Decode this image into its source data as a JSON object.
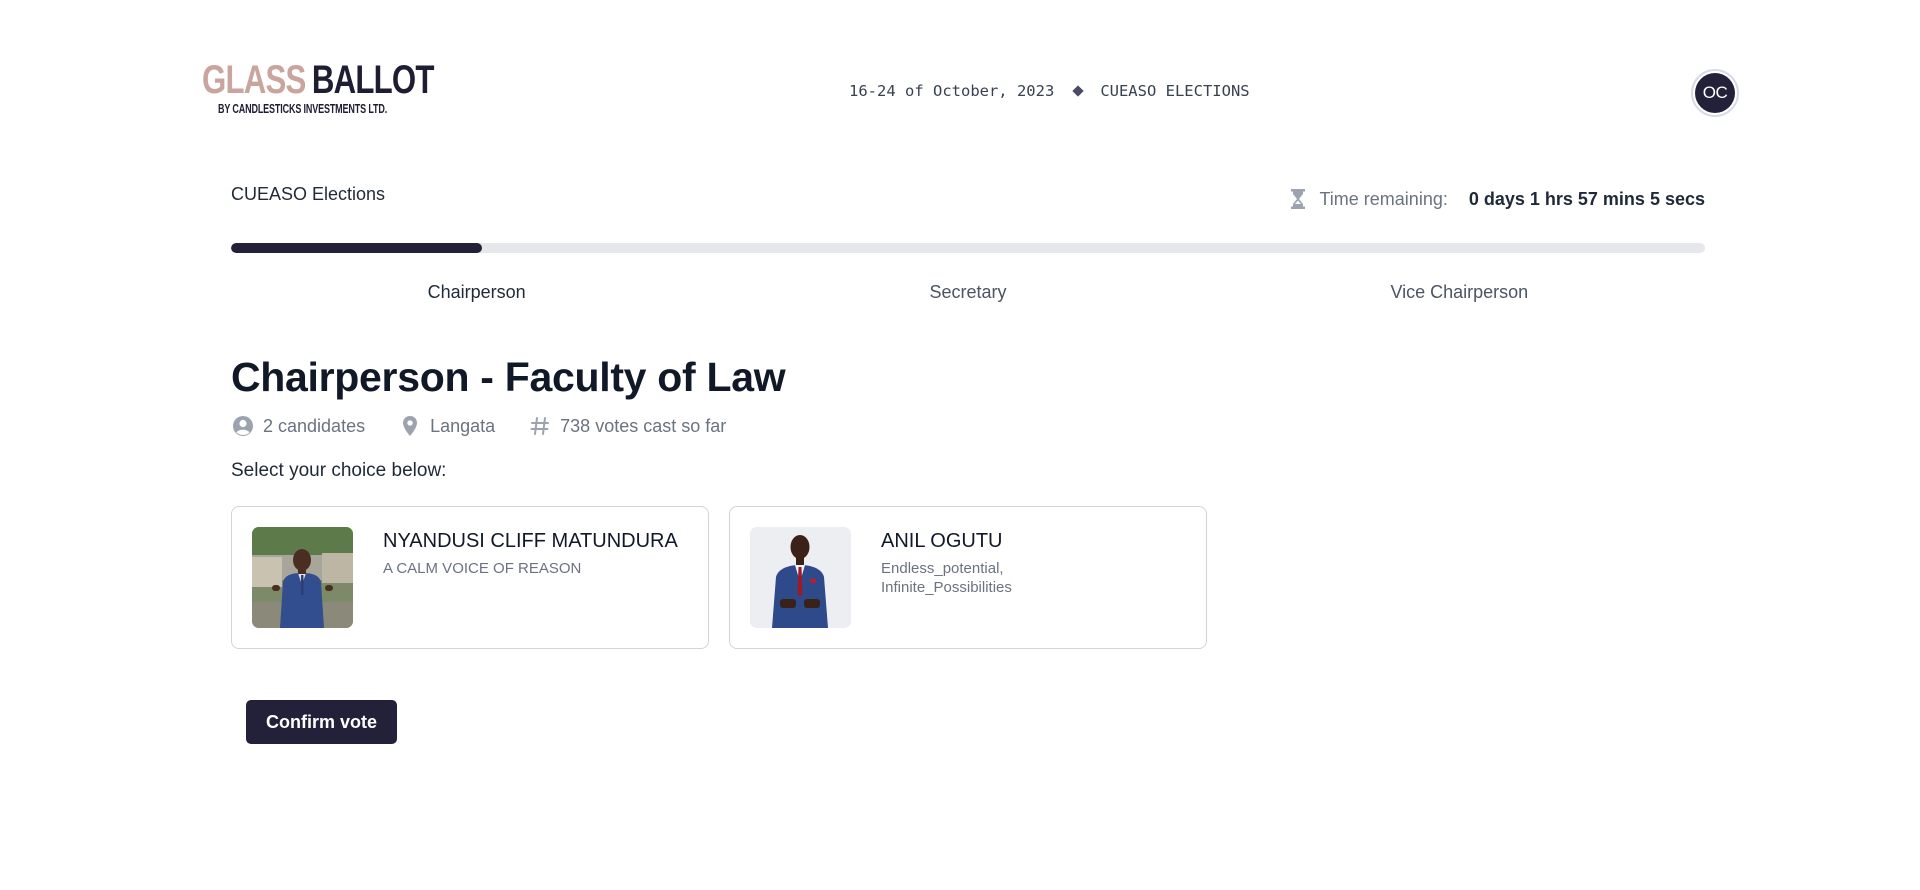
{
  "header": {
    "logo": {
      "word1": "GLASS",
      "word2": "BALLOT",
      "subtitle": "BY CANDLESTICKS INVESTMENTS LTD."
    },
    "event_dates": "16-24 of October, 2023",
    "event_name": "CUEASO ELECTIONS",
    "user_initials": "OC"
  },
  "election": {
    "title": "CUEASO Elections",
    "time_label": "Time remaining:",
    "time_value": "0 days 1 hrs 57 mins 5 secs",
    "progress_fraction": 0.17,
    "steps": [
      {
        "label": "Chairperson",
        "active": true
      },
      {
        "label": "Secretary",
        "active": false
      },
      {
        "label": "Vice Chairperson",
        "active": false
      }
    ]
  },
  "position": {
    "title": "Chairperson - Faculty of Law",
    "candidates_count": "2 candidates",
    "location": "Langata",
    "votes": "738 votes cast so far",
    "instruction": "Select your choice below:"
  },
  "candidates": [
    {
      "name": "NYANDUSI CLIFF MATUNDURA",
      "slogan": "A CALM VOICE OF REASON"
    },
    {
      "name": "ANIL OGUTU",
      "slogan": "Endless_potential, Infinite_Possibilities"
    }
  ],
  "actions": {
    "confirm_label": "Confirm vote"
  },
  "colors": {
    "primary": "#23213a",
    "logo_accent": "#c9a59d",
    "track": "#e5e7eb"
  },
  "icons": {
    "timer": "hourglass-icon",
    "candidates": "user-circle-icon",
    "location": "map-pin-icon",
    "votes": "hash-icon"
  }
}
